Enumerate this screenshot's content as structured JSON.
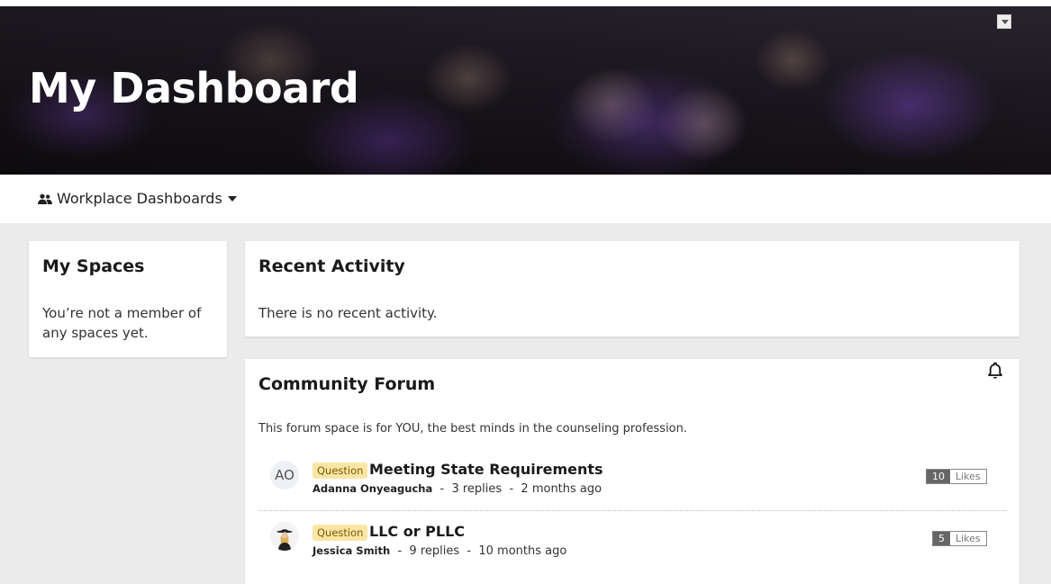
{
  "header": {
    "title": "My Dashboard"
  },
  "subnav": {
    "dashboards_label": "Workplace Dashboards"
  },
  "my_spaces": {
    "title": "My Spaces",
    "empty_text": "You’re not a member of any spaces yet."
  },
  "recent_activity": {
    "title": "Recent Activity",
    "empty_text": "There is no recent activity."
  },
  "forum": {
    "title": "Community Forum",
    "description": "This forum space is for YOU, the best minds in the counseling profession.",
    "posts": [
      {
        "avatar_initials": "AO",
        "tag": "Question",
        "title": "Meeting State Requirements",
        "author": "Adanna Onyeagucha",
        "replies": "3 replies",
        "age": "2 months ago",
        "likes_count": "10",
        "likes_label": "Likes"
      },
      {
        "avatar_icon": "user-photo-icon",
        "tag": "Question",
        "title": "LLC or PLLC",
        "author": "Jessica Smith",
        "replies": "9 replies",
        "age": "10 months ago",
        "likes_count": "5",
        "likes_label": "Likes"
      }
    ],
    "separator": "-"
  }
}
